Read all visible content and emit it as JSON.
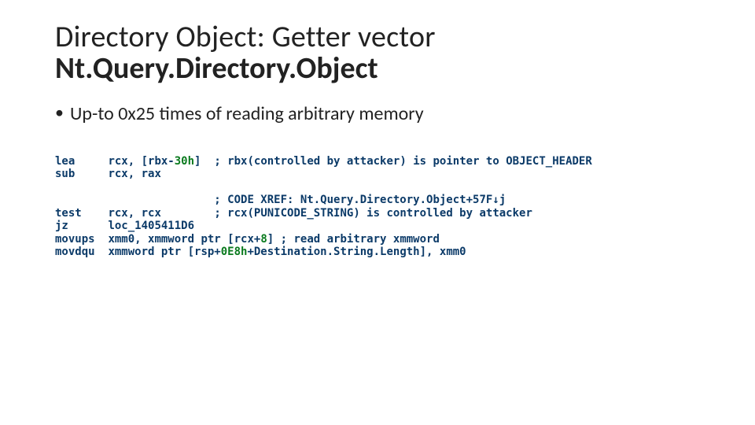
{
  "title": {
    "line1": "Directory Object: Getter vector",
    "line2": "Nt.Query.Directory.Object"
  },
  "bullet": {
    "dot": "•",
    "text": "Up-to 0x25 times of reading arbitrary memory"
  },
  "code": {
    "l1_mnem": "lea",
    "l1_ops_a": "rcx, [rbx-",
    "l1_num": "30h",
    "l1_ops_b": "]",
    "l1_cmt": "; rbx(controlled by attacker) is pointer to OBJECT_HEADER",
    "l2_mnem": "sub",
    "l2_ops": "rcx, rax",
    "l3_cmt": "; CODE XREF: Nt.Query.Directory.Object+57F↓j",
    "l4_mnem": "test",
    "l4_ops": "rcx, rcx",
    "l4_cmt": "; rcx(PUNICODE_STRING) is controlled by attacker",
    "l5_mnem": "jz",
    "l5_ops": "loc_1405411D6",
    "l6_mnem": "movups",
    "l6_ops_a": "xmm0, xmmword ptr [rcx+",
    "l6_num": "8",
    "l6_ops_b": "] ",
    "l6_cmt": "; read arbitrary xmmword",
    "l7_mnem": "movdqu",
    "l7_ops_a": "xmmword ptr [rsp+",
    "l7_num": "0E8h",
    "l7_ops_b": "+Destination.String.Length], xmm0"
  }
}
